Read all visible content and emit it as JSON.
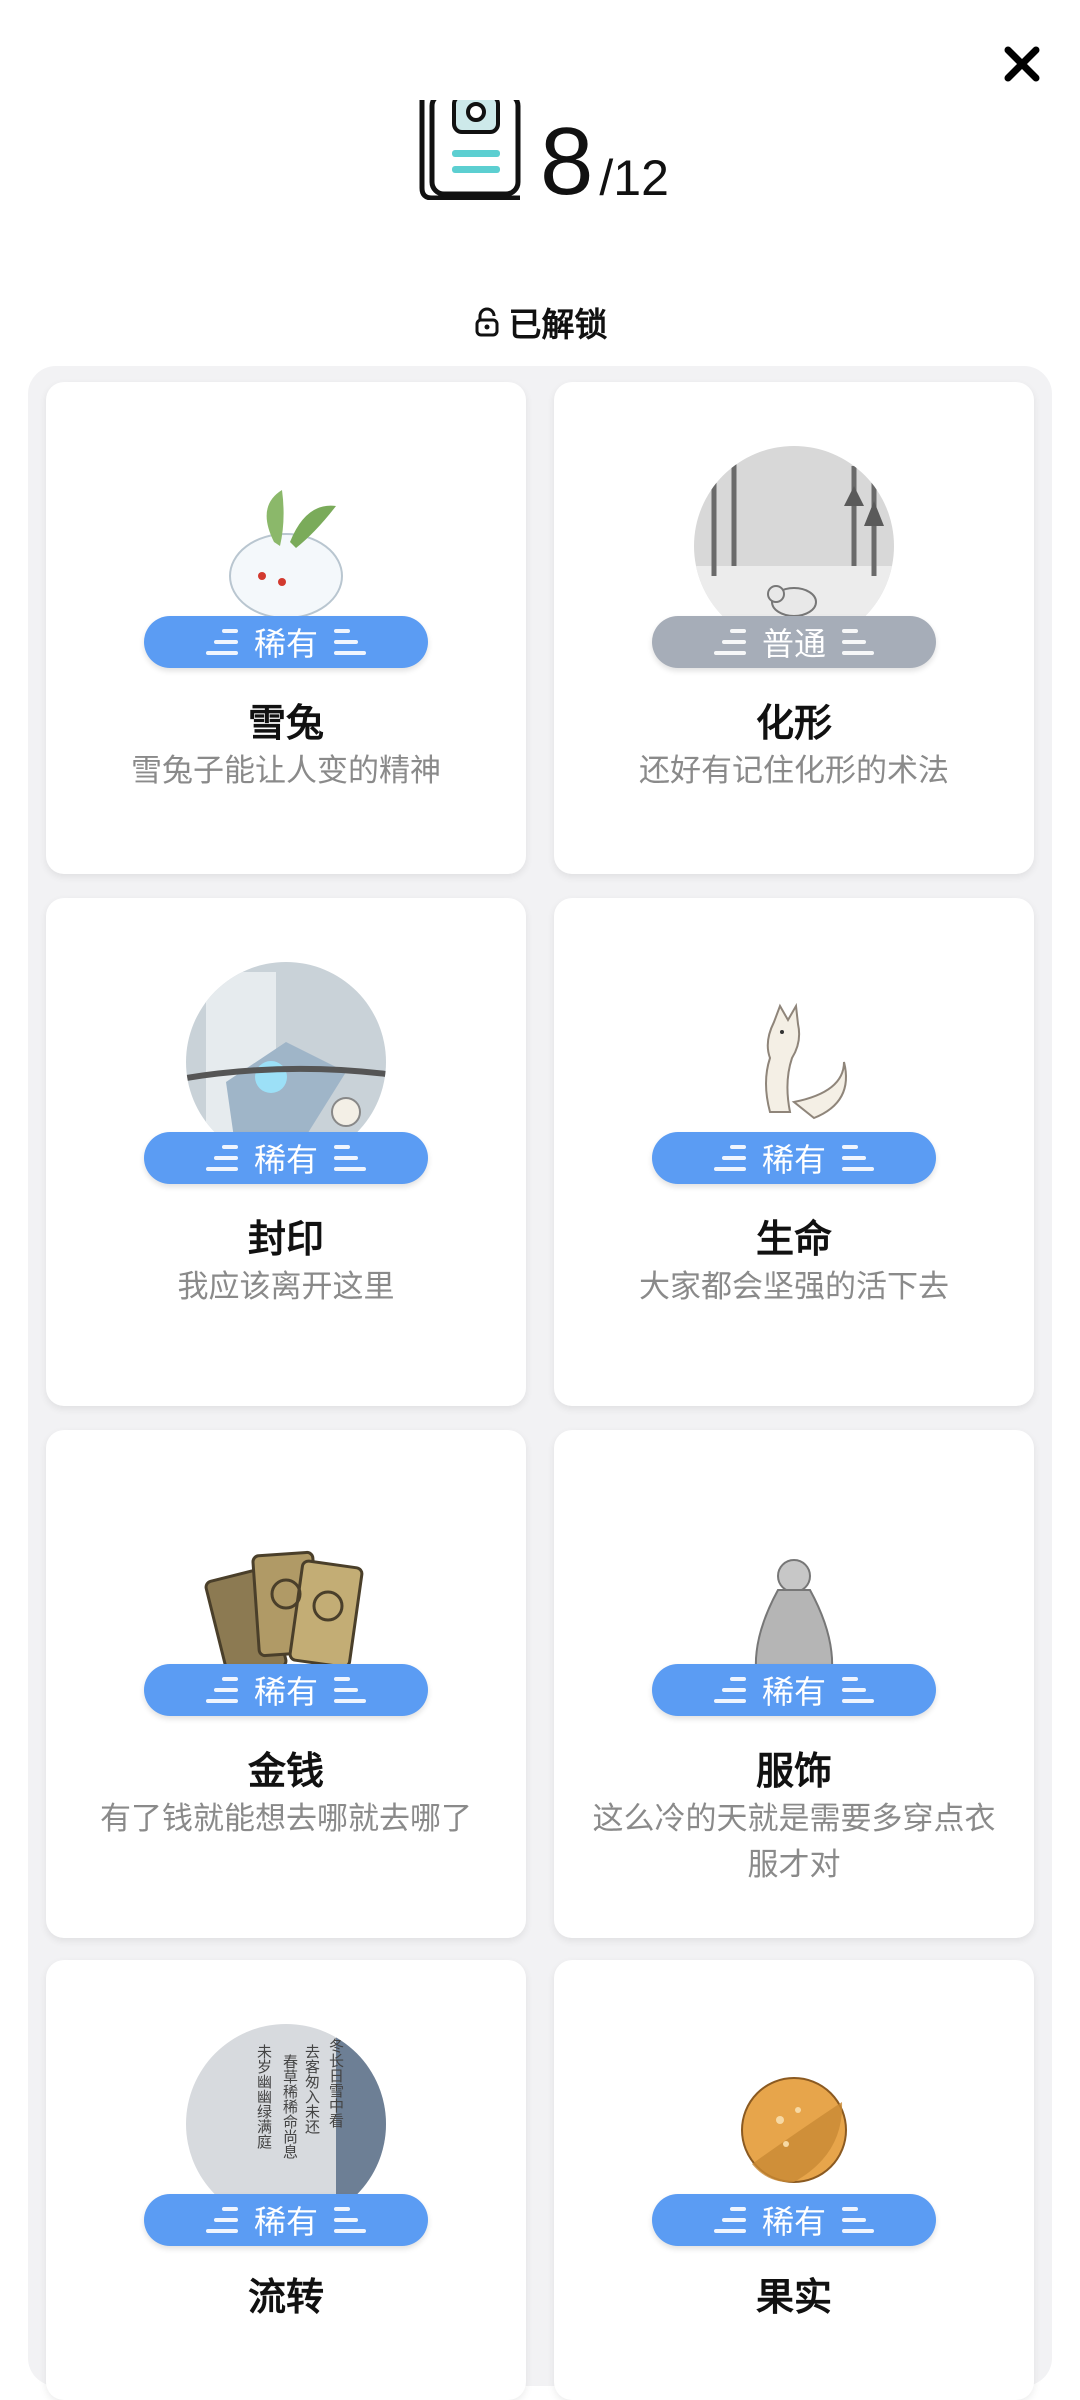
{
  "header": {
    "collected": "8",
    "total": "/12"
  },
  "section": {
    "unlocked_label": "已解锁"
  },
  "cards": [
    {
      "title": "雪兔",
      "rarity": "稀有",
      "desc": "雪兔子能让人变的精神",
      "icon": "snow-rabbit"
    },
    {
      "title": "化形",
      "rarity": "普通",
      "desc": "还好有记住化形的术法",
      "icon": "snowy-forest-fox"
    },
    {
      "title": "封印",
      "rarity": "稀有",
      "desc": "我应该离开这里",
      "icon": "seal-spirit"
    },
    {
      "title": "生命",
      "rarity": "稀有",
      "desc": "大家都会坚强的活下去",
      "icon": "white-fox"
    },
    {
      "title": "金钱",
      "rarity": "稀有",
      "desc": "有了钱就能想去哪就去哪了",
      "icon": "coins"
    },
    {
      "title": "服饰",
      "rarity": "稀有",
      "desc": "这么冷的天就是需要多穿点衣服才对",
      "icon": "robed-figure"
    },
    {
      "title": "流转",
      "rarity": "稀有",
      "desc": "",
      "icon": "scroll-text"
    },
    {
      "title": "果实",
      "rarity": "稀有",
      "desc": "",
      "icon": "orange-fruit"
    }
  ],
  "scroll_text": [
    "去客匆入未还",
    "春草稀稀命尚息",
    "未岁幽幽绿满庭",
    "冬长日雪中看"
  ],
  "colors": {
    "rare": "#5b9cf3",
    "common": "#a6adb8",
    "panel": "#f2f2f4"
  }
}
